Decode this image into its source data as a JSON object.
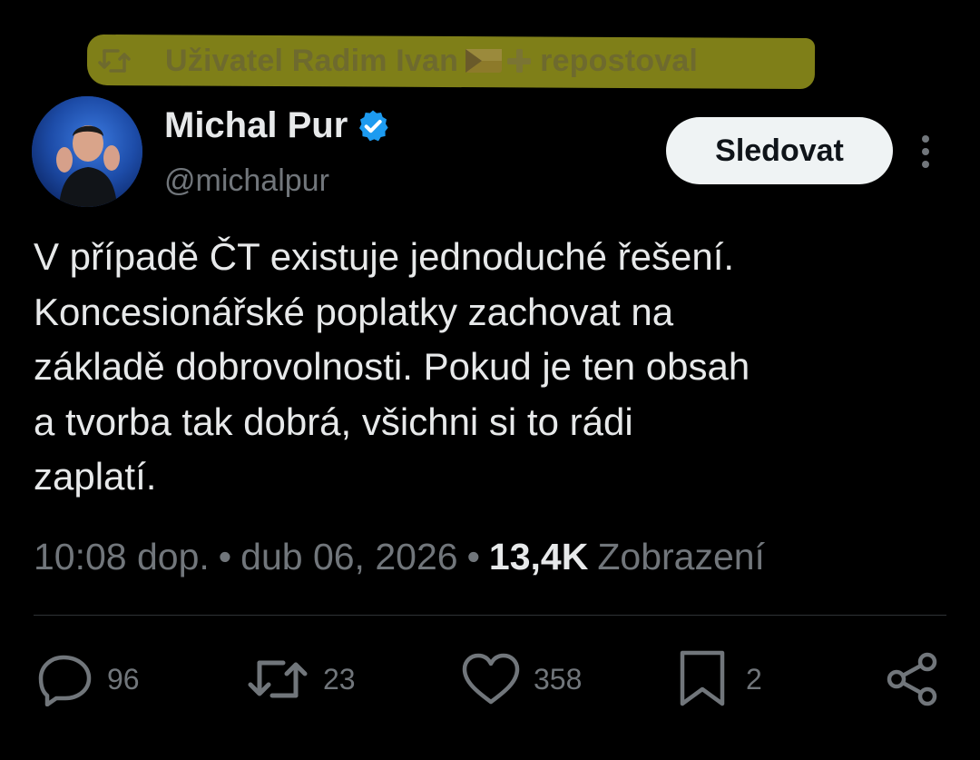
{
  "repost": {
    "prefix": "Uživatel Radim Ivan",
    "suffix": "repostoval",
    "flag_emoji": "flag-icon",
    "plus_emoji": "plus-icon"
  },
  "author": {
    "name": "Michal Pur",
    "handle": "@michalpur",
    "verified": true
  },
  "follow_label": "Sledovat",
  "post": {
    "text": "V případě ČT existuje jednoduché řešení.\nKoncesionářské poplatky zachovat na\nzákladě dobrovolnosti. Pokud je ten obsah\na tvorba tak dobrá, všichni si to rádi\nzaplatí."
  },
  "meta": {
    "time": "10:08 dop.",
    "date": "dub 06, 2026",
    "views_count": "13,4K",
    "views_label": "Zobrazení",
    "separator": "•"
  },
  "actions": {
    "replies": "96",
    "reposts": "23",
    "likes": "358",
    "bookmarks": "2"
  },
  "colors": {
    "background": "#000000",
    "text": "#e7e9ea",
    "secondary": "#71767b",
    "verified": "#1d9bf0",
    "highlight": "#8a8a1a"
  }
}
